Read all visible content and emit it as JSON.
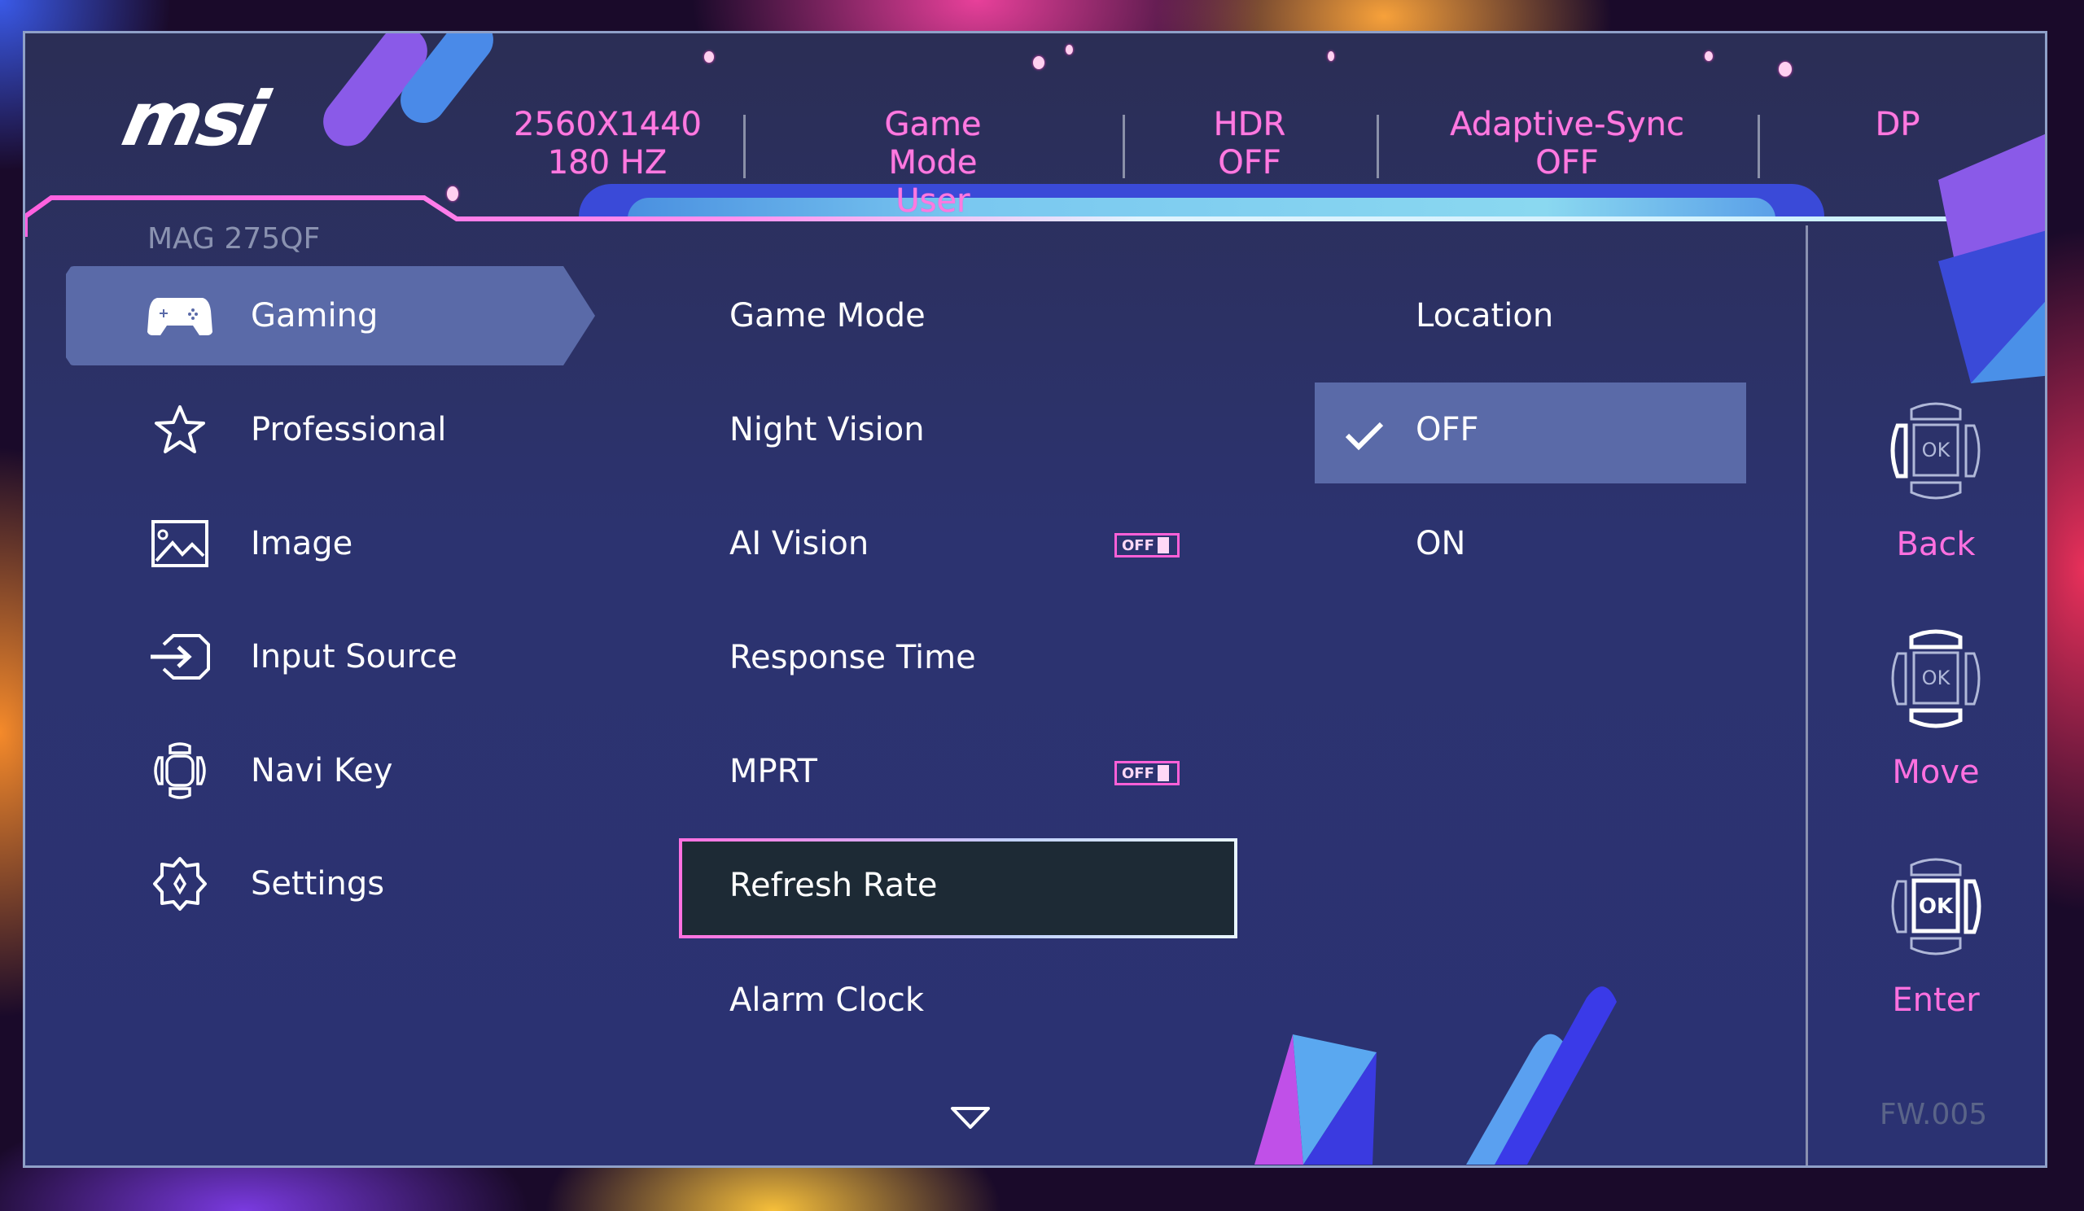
{
  "brand": {
    "logo_text": "msi",
    "model": "MAG 275QF"
  },
  "status_bar": [
    {
      "line1": "2560X1440",
      "line2": "180 HZ"
    },
    {
      "line1": "Game Mode",
      "line2": "User"
    },
    {
      "line1": "HDR",
      "line2": "OFF"
    },
    {
      "line1": "Adaptive-Sync",
      "line2": "OFF"
    },
    {
      "line1": "DP",
      "line2": ""
    }
  ],
  "sidebar": {
    "items": [
      {
        "label": "Gaming",
        "icon": "gamepad-icon",
        "active": true
      },
      {
        "label": "Professional",
        "icon": "star-icon",
        "active": false
      },
      {
        "label": "Image",
        "icon": "image-icon",
        "active": false
      },
      {
        "label": "Input Source",
        "icon": "input-source-icon",
        "active": false
      },
      {
        "label": "Navi Key",
        "icon": "navi-key-icon",
        "active": false
      },
      {
        "label": "Settings",
        "icon": "gear-icon",
        "active": false
      }
    ]
  },
  "submenu": {
    "items": [
      {
        "label": "Game Mode",
        "toggle": null
      },
      {
        "label": "Night Vision",
        "toggle": null
      },
      {
        "label": "AI Vision",
        "toggle": "OFF"
      },
      {
        "label": "Response Time",
        "toggle": null
      },
      {
        "label": "MPRT",
        "toggle": "OFF"
      },
      {
        "label": "Refresh Rate",
        "toggle": null,
        "selected": true
      },
      {
        "label": "Alarm Clock",
        "toggle": null
      }
    ],
    "more_indicator": "chevron-down-icon"
  },
  "options": {
    "title": "Location",
    "items": [
      {
        "label": "OFF",
        "checked": true
      },
      {
        "label": "ON",
        "checked": false
      }
    ]
  },
  "key_guide": [
    {
      "label": "Back",
      "icon": "joystick-left-icon"
    },
    {
      "label": "Move",
      "icon": "joystick-up-down-icon"
    },
    {
      "label": "Enter",
      "icon": "joystick-ok-icon"
    }
  ],
  "firmware": "FW.005",
  "colors": {
    "accent_pink": "#ff70e0",
    "panel_bg": "#2c3370",
    "highlight": "#5a6aa8",
    "selected_bg": "#1d2a35"
  }
}
